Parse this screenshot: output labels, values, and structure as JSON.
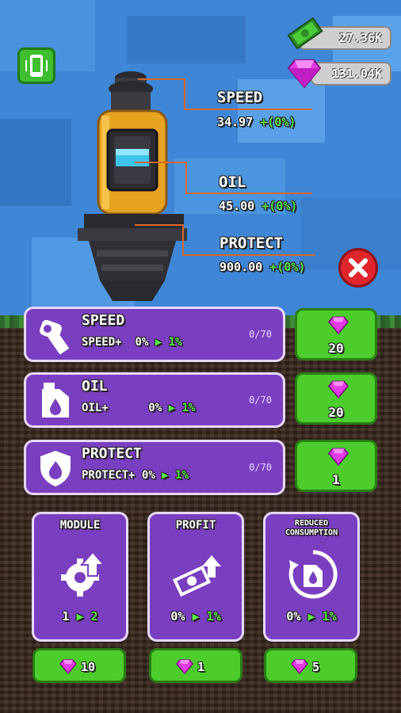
{
  "currency": {
    "cash": "27.36K",
    "gems": "131.04K"
  },
  "stats": [
    {
      "label": "SPEED",
      "value": "34.97",
      "bonus": "+(0%)"
    },
    {
      "label": "OIL",
      "value": "45.00",
      "bonus": "+(0%)"
    },
    {
      "label": "PROTECT",
      "value": "900.00",
      "bonus": "+(0%)"
    }
  ],
  "upgrades": [
    {
      "title": "SPEED",
      "sub_name": "SPEED+",
      "from": "0%",
      "to": "1%",
      "count": "0/70",
      "cost": "20",
      "icon": "speed-icon"
    },
    {
      "title": "OIL",
      "sub_name": "OIL+",
      "from": "0%",
      "to": "1%",
      "count": "0/70",
      "cost": "20",
      "icon": "oil-can-icon"
    },
    {
      "title": "PROTECT",
      "sub_name": "PROTECT+",
      "from": "0%",
      "to": "1%",
      "count": "0/70",
      "cost": "1",
      "icon": "shield-icon"
    }
  ],
  "cards": [
    {
      "title": "MODULE",
      "from": "1",
      "to": "2",
      "cost": "10",
      "icon": "gear-upgrade-icon"
    },
    {
      "title": "PROFIT",
      "from": "0%",
      "to": "1%",
      "cost": "1",
      "icon": "money-upgrade-icon"
    },
    {
      "title_line1": "REDUCED",
      "title_line2": "CONSUMPTION",
      "from": "0%",
      "to": "1%",
      "cost": "5",
      "icon": "fuel-refresh-icon"
    }
  ],
  "colors": {
    "accent_purple": "#7a3fc0",
    "button_green": "#4ccd2c",
    "bonus_green": "#5be64b",
    "close_red": "#e0262c",
    "leader_orange": "#d8672a"
  }
}
